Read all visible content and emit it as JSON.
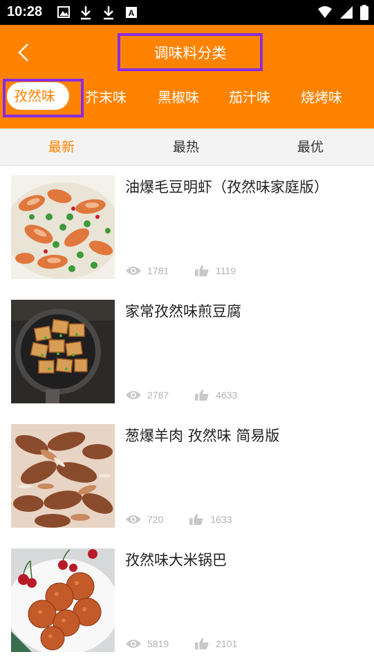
{
  "status_bar": {
    "time": "10:28",
    "left_icons": [
      "image-icon",
      "download-icon",
      "download-icon",
      "a-icon"
    ],
    "right_icons": [
      "wifi-icon",
      "signal-icon",
      "battery-icon"
    ]
  },
  "header": {
    "title": "调味料分类",
    "back_icon": "chevron-left-icon",
    "background_color": "#ff8300",
    "highlight_color": "#8a2be2"
  },
  "tabs": [
    {
      "label": "孜然味",
      "active": true
    },
    {
      "label": "芥末味",
      "active": false
    },
    {
      "label": "黑椒味",
      "active": false
    },
    {
      "label": "茄汁味",
      "active": false
    },
    {
      "label": "烧烤味",
      "active": false
    }
  ],
  "sort": {
    "items": [
      {
        "label": "最新",
        "active": true
      },
      {
        "label": "最热",
        "active": false
      },
      {
        "label": "最优",
        "active": false
      }
    ],
    "active_color": "#ff8300"
  },
  "recipes": [
    {
      "title": "油爆毛豆明虾（孜然味家庭版）",
      "views": "1781",
      "likes": "1119"
    },
    {
      "title": "家常孜然味煎豆腐",
      "views": "2787",
      "likes": "4633"
    },
    {
      "title": "葱爆羊肉 孜然味 简易版",
      "views": "720",
      "likes": "1633"
    },
    {
      "title": "孜然味大米锅巴",
      "views": "5819",
      "likes": "2101"
    }
  ]
}
